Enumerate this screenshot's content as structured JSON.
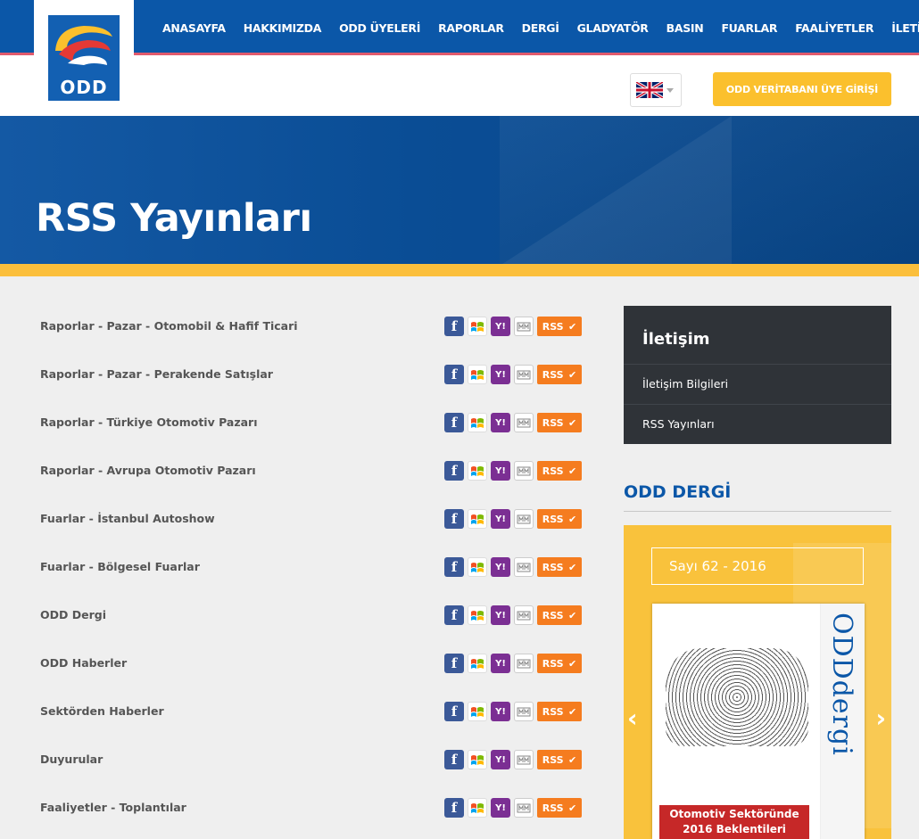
{
  "header": {
    "logo_text": "ODD",
    "nav": [
      "ANASAYFA",
      "HAKKIMIZDA",
      "ODD ÜYELERİ",
      "RAPORLAR",
      "DERGİ",
      "GLADYATÖR",
      "BASIN",
      "FUARLAR",
      "FAALİYETLER",
      "İLETİŞİM"
    ],
    "language_flag": "uk-flag-icon",
    "login_button": "ODD VERİTABANI ÜYE GİRİŞİ"
  },
  "banner": {
    "title": "RSS Yayınları"
  },
  "rss_list": [
    "Raporlar - Pazar - Otomobil & Hafif Ticari",
    "Raporlar - Pazar - Perakende Satışlar",
    "Raporlar - Türkiye Otomotiv Pazarı",
    "Raporlar - Avrupa Otomotiv Pazarı",
    "Fuarlar - İstanbul Autoshow",
    "Fuarlar - Bölgesel Fuarlar",
    "ODD Dergi",
    "ODD Haberler",
    "Sektörden Haberler",
    "Duyurular",
    "Faaliyetler - Toplantılar"
  ],
  "rss_icons": {
    "facebook": "f",
    "yahoo": "Y!",
    "rss_label": "RSS",
    "check": "✔"
  },
  "sidebar": {
    "title": "İletişim",
    "items": [
      "İletişim Bilgileri",
      "RSS Yayınları"
    ]
  },
  "magazine": {
    "heading": "ODD DERGİ",
    "issue": "Sayı 62 - 2016",
    "cover_brand": "ODDdergi",
    "headline_line1": "Otomotiv Sektöründe",
    "headline_line2": "2016 Beklentileri",
    "prev": "‹",
    "next": "›"
  },
  "colors": {
    "primary": "#0b57a8",
    "accent": "#fbbf3c",
    "dark": "#2f3338",
    "rss": "#f57c1f"
  }
}
